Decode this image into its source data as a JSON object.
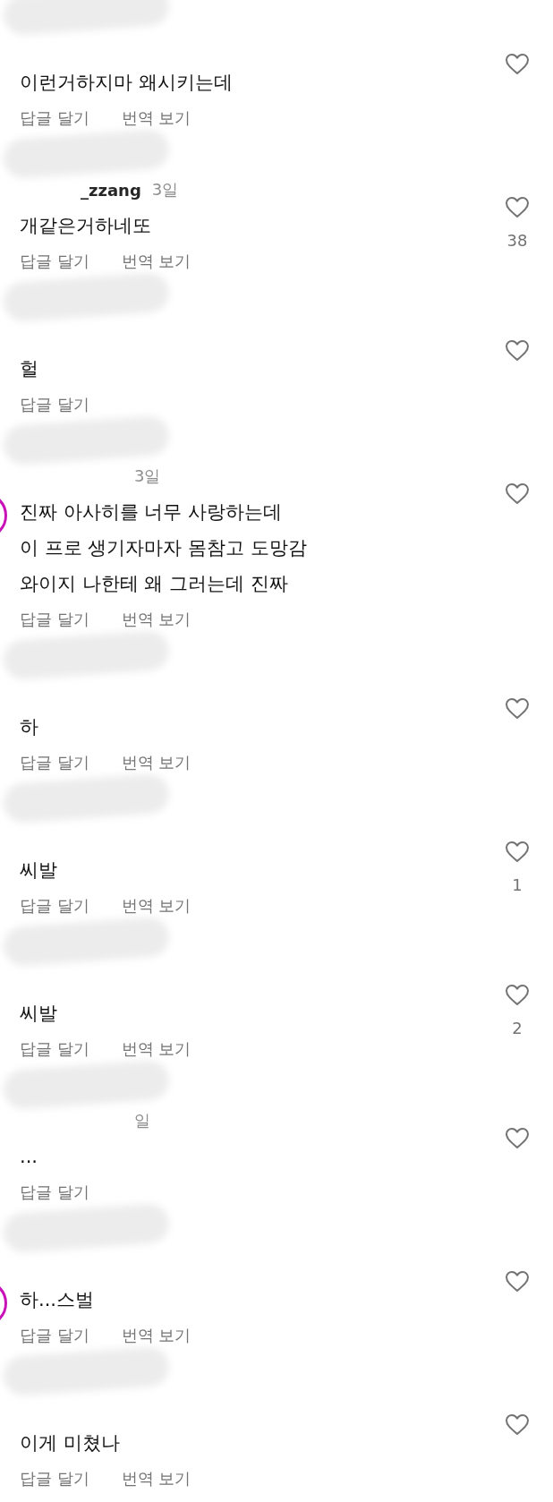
{
  "comments": [
    {
      "story_ring": false,
      "lines": [
        "이런거하지마 왜시키는데"
      ],
      "reply": "답글 달기",
      "translate": "번역 보기"
    },
    {
      "time": "3일",
      "name_visible": "_zzang",
      "story_ring": false,
      "lines": [
        "개같은거하네또"
      ],
      "reply": "답글 달기",
      "translate": "번역 보기",
      "likes": "38"
    },
    {
      "story_ring": false,
      "lines": [
        "헐"
      ],
      "reply": "답글 달기"
    },
    {
      "time": "3일",
      "story_ring": true,
      "lines": [
        "진짜 아사히를 너무 사랑하는데",
        "이 프로 생기자마자 몸참고 도망감",
        "와이지 나한테 왜 그러는데 진짜"
      ],
      "reply": "답글 달기",
      "translate": "번역 보기"
    },
    {
      "story_ring": false,
      "lines": [
        "하"
      ],
      "reply": "답글 달기",
      "translate": "번역 보기"
    },
    {
      "story_ring": false,
      "lines": [
        "씨발"
      ],
      "reply": "답글 달기",
      "translate": "번역 보기",
      "likes": "1"
    },
    {
      "story_ring": false,
      "lines": [
        "씨발"
      ],
      "reply": "답글 달기",
      "translate": "번역 보기",
      "likes": "2"
    },
    {
      "time": "일",
      "story_ring": false,
      "lines": [
        "..."
      ],
      "reply": "답글 달기"
    },
    {
      "story_ring": true,
      "lines": [
        "하...스벌"
      ],
      "reply": "답글 달기",
      "translate": "번역 보기"
    },
    {
      "story_ring": false,
      "lines": [
        "이게 미쳤나"
      ],
      "reply": "답글 달기",
      "translate": "번역 보기"
    }
  ]
}
